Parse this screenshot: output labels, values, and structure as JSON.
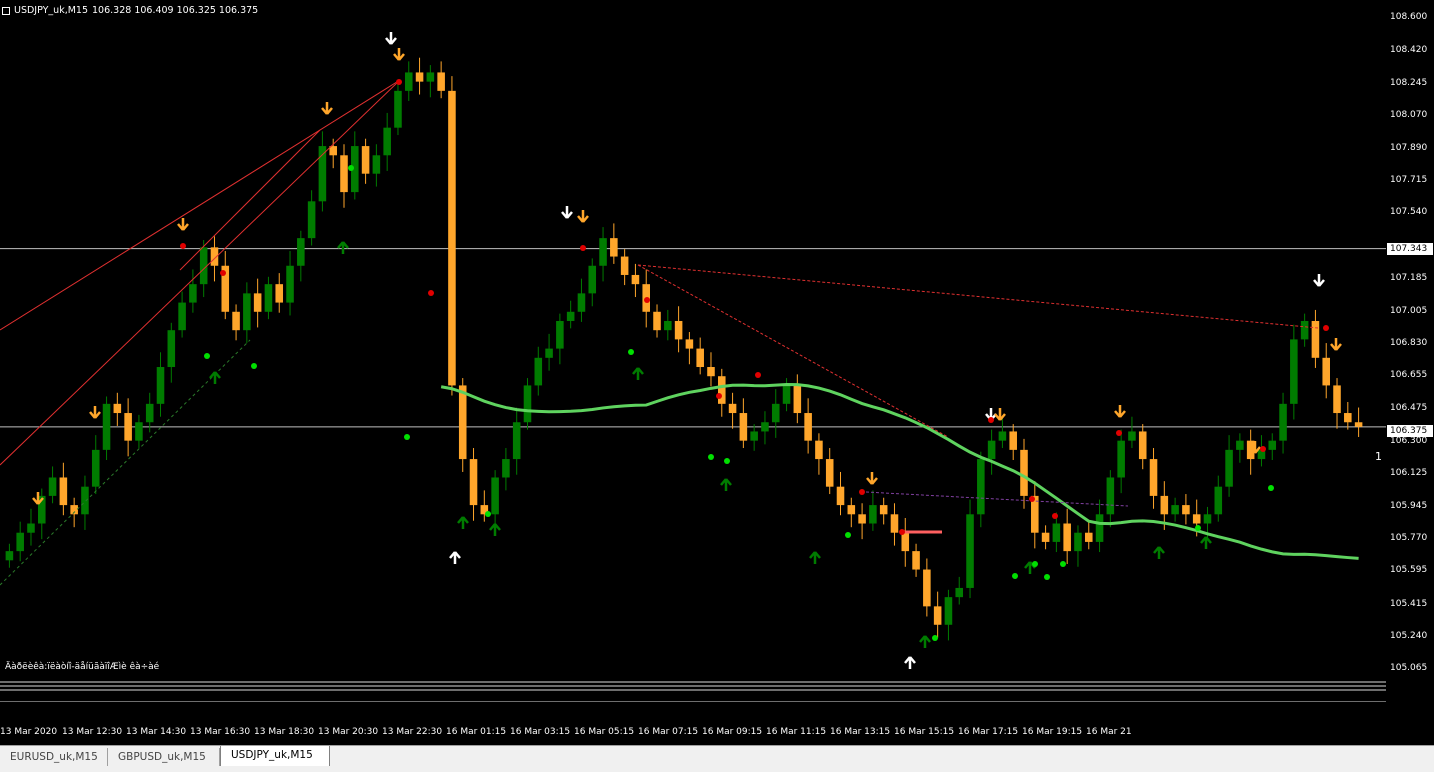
{
  "window": {
    "info_title": "USDJPY_uk,M15",
    "ohlc": "106.328 106.409 106.325 106.375",
    "indicator_label": "Äàðëèêà:ïëàòíî-äåíüãàïîÆìè êà÷àé",
    "edge_label": "1"
  },
  "price_scale": {
    "labels": [
      "108.600",
      "108.420",
      "108.245",
      "108.070",
      "107.890",
      "107.715",
      "107.540",
      "107.185",
      "107.005",
      "106.830",
      "106.655",
      "106.475",
      "106.300",
      "106.125",
      "105.945",
      "105.770",
      "105.595",
      "105.415",
      "105.240",
      "105.065"
    ],
    "tags": {
      "level": "107.343",
      "current": "106.375"
    }
  },
  "time_axis": {
    "labels": [
      "13 Mar 2020",
      "13 Mar 12:30",
      "13 Mar 14:30",
      "13 Mar 16:30",
      "13 Mar 18:30",
      "13 Mar 20:30",
      "13 Mar 22:30",
      "16 Mar 01:15",
      "16 Mar 03:15",
      "16 Mar 05:15",
      "16 Mar 07:15",
      "16 Mar 09:15",
      "16 Mar 11:15",
      "16 Mar 13:15",
      "16 Mar 15:15",
      "16 Mar 17:15",
      "16 Mar 19:15",
      "16 Mar 21"
    ]
  },
  "tabs": [
    {
      "label": "EURUSD_uk,M15",
      "active": false
    },
    {
      "label": "GBPUSD_uk,M15",
      "active": false
    },
    {
      "label": "USDJPY_uk,M15",
      "active": true
    }
  ],
  "colors": {
    "bull": "#007c00",
    "bear": "#ffa62b",
    "ma": "#5fd35f",
    "sell_dot": "#e10000",
    "buy_dot": "#00e000",
    "grid": "#c0c0c0",
    "trend_red": "#e03030"
  },
  "chart_data": {
    "type": "candlestick",
    "symbol": "USDJPY_uk",
    "timeframe": "M15",
    "ylim": [
      105.0,
      108.65
    ],
    "horizontal_levels": [
      107.343,
      106.375
    ],
    "closes": [
      105.7,
      105.8,
      105.85,
      106.0,
      106.1,
      105.95,
      105.9,
      106.05,
      106.25,
      106.5,
      106.45,
      106.3,
      106.4,
      106.5,
      106.7,
      106.9,
      107.05,
      107.15,
      107.35,
      107.25,
      107.0,
      106.9,
      107.1,
      107.0,
      107.15,
      107.05,
      107.25,
      107.4,
      107.6,
      107.9,
      107.85,
      107.65,
      107.9,
      107.75,
      107.85,
      108.0,
      108.2,
      108.3,
      108.25,
      108.3,
      108.2,
      106.6,
      106.2,
      105.95,
      105.9,
      106.1,
      106.2,
      106.4,
      106.6,
      106.75,
      106.8,
      106.95,
      107.0,
      107.1,
      107.25,
      107.4,
      107.3,
      107.2,
      107.15,
      107.0,
      106.9,
      106.95,
      106.85,
      106.8,
      106.7,
      106.65,
      106.5,
      106.45,
      106.3,
      106.35,
      106.4,
      106.5,
      106.6,
      106.45,
      106.3,
      106.2,
      106.05,
      105.95,
      105.9,
      105.85,
      105.95,
      105.9,
      105.8,
      105.7,
      105.6,
      105.4,
      105.3,
      105.45,
      105.5,
      105.9,
      106.2,
      106.3,
      106.35,
      106.25,
      106.0,
      105.8,
      105.75,
      105.85,
      105.7,
      105.8,
      105.75,
      105.9,
      106.1,
      106.3,
      106.35,
      106.2,
      106.0,
      105.9,
      105.95,
      105.9,
      105.85,
      105.9,
      106.05,
      106.25,
      106.3,
      106.2,
      106.25,
      106.3,
      106.5,
      106.85,
      106.95,
      106.75,
      106.6,
      106.45,
      106.4,
      106.375
    ]
  }
}
